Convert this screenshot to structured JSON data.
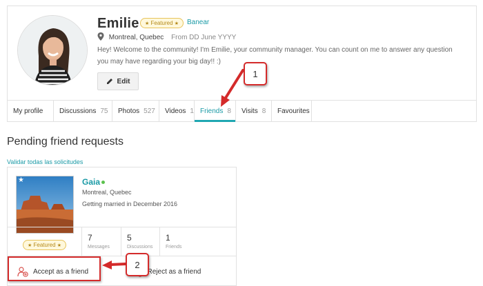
{
  "profile": {
    "name": "Emilie",
    "featured_label": "Featured",
    "ban_label": "Banear",
    "location": "Montreal, Quebec",
    "from_text": "From DD June YYYY",
    "bio": "Hey! Welcome to the community! I'm Emilie, your community manager. You can count on me to answer any question you may have regarding your big day!! :)",
    "edit_label": "Edit"
  },
  "tabs": [
    {
      "label": "My profile",
      "count": ""
    },
    {
      "label": "Discussions",
      "count": "75"
    },
    {
      "label": "Photos",
      "count": "527"
    },
    {
      "label": "Videos",
      "count": "1"
    },
    {
      "label": "Friends",
      "count": "8",
      "active": true
    },
    {
      "label": "Visits",
      "count": "8"
    },
    {
      "label": "Favourites",
      "count": ""
    }
  ],
  "section": {
    "title": "Pending friend requests",
    "validate_all": "Validar todas las solicitudes"
  },
  "friend": {
    "name": "Gaia",
    "location": "Montreal, Quebec",
    "wedding": "Getting married in December 2016",
    "featured_label": "Featured",
    "stats": [
      {
        "num": "7",
        "label": "Messages"
      },
      {
        "num": "5",
        "label": "Discussions"
      },
      {
        "num": "1",
        "label": "Friends"
      }
    ],
    "accept_label": "Accept as a friend",
    "reject_label": "Reject as a friend"
  },
  "annotations": {
    "step1": "1",
    "step2": "2",
    "color": "#d42a2a"
  },
  "colors": {
    "accent": "#1a9aa6",
    "online": "#5cc24e",
    "badge_gold": "#e7c35a"
  }
}
